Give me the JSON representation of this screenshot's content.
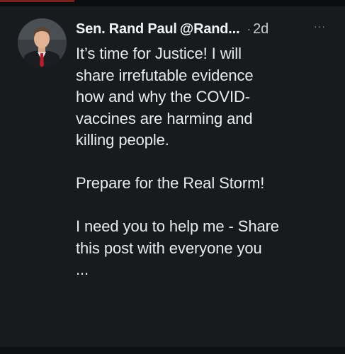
{
  "tweet": {
    "author_name": "Sen. Rand Paul",
    "handle": "@Rand...",
    "separator": "·",
    "time": "2d",
    "more_label": "···",
    "lines": [
      "It’s time for Justice! I will",
      "share irrefutable evidence",
      "how and why the COVID-",
      "vaccines are harming and",
      "killing people.",
      "",
      "Prepare for the Real Storm!",
      "",
      "I need you to help me - Share",
      "this post with everyone you",
      "..."
    ]
  },
  "colors": {
    "background": "#181a1d",
    "text": "#e9ebed",
    "muted": "#8b9095",
    "accent_strip": "#7a1e1e"
  },
  "icons": {
    "avatar": "profile-photo",
    "more": "more-options-icon"
  }
}
